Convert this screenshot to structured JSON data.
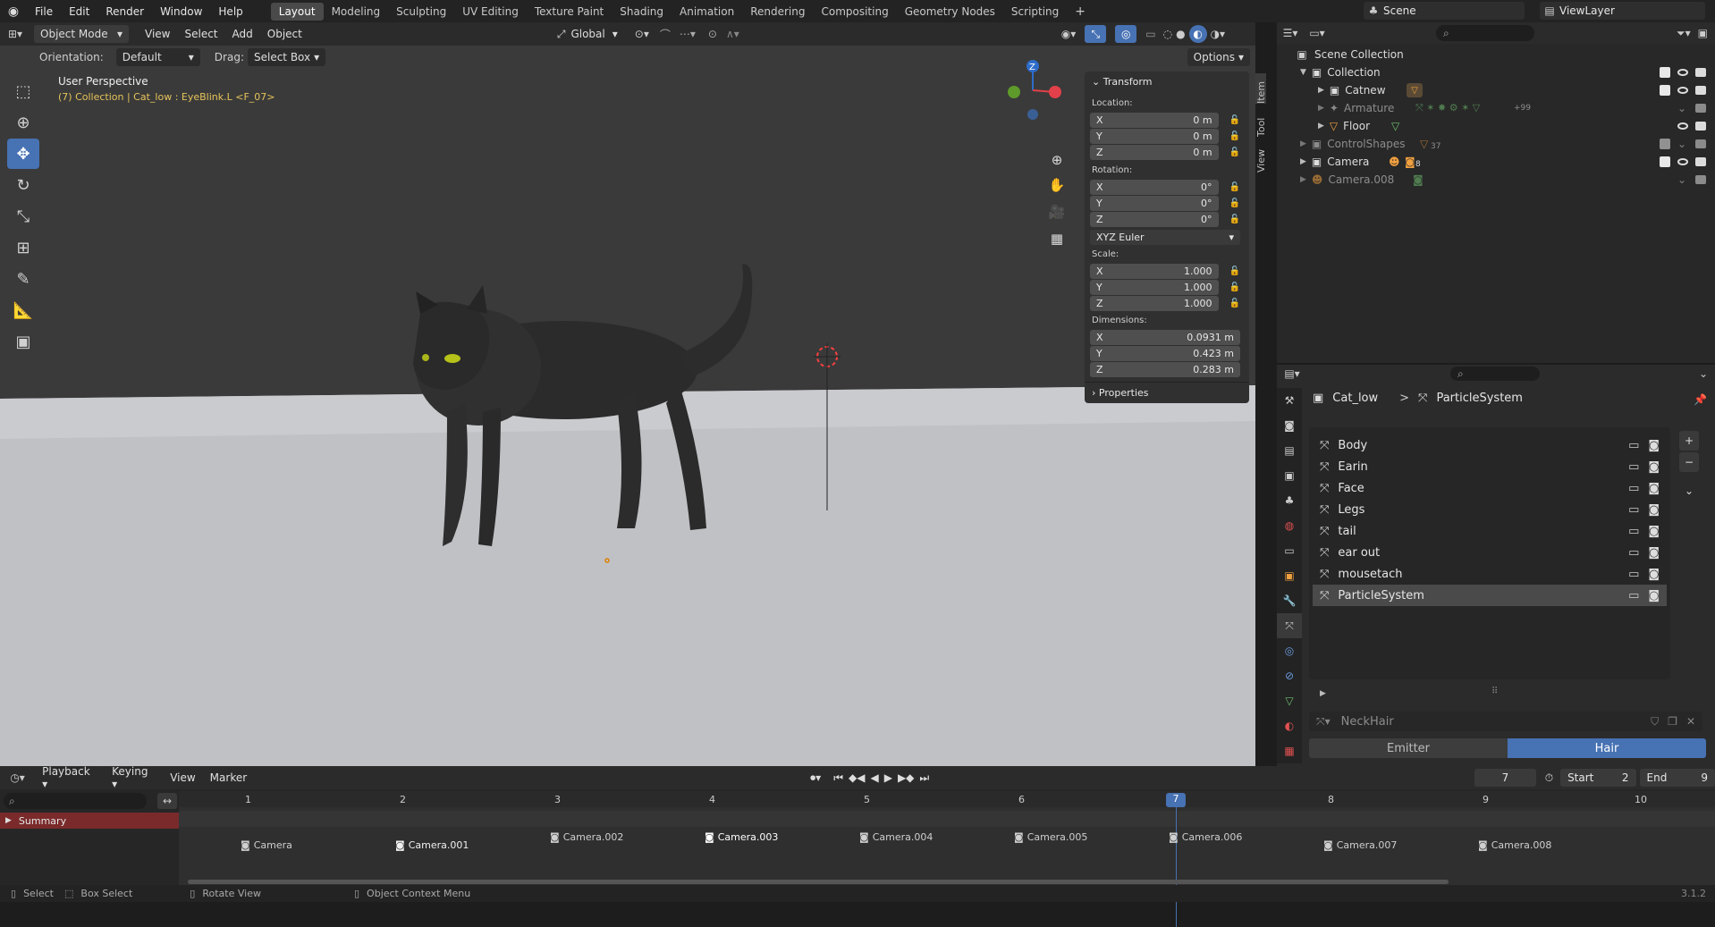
{
  "topbar": {
    "menus": [
      "File",
      "Edit",
      "Render",
      "Window",
      "Help"
    ],
    "workspaces": [
      "Layout",
      "Modeling",
      "Sculpting",
      "UV Editing",
      "Texture Paint",
      "Shading",
      "Animation",
      "Rendering",
      "Compositing",
      "Geometry Nodes",
      "Scripting"
    ],
    "active_workspace": "Layout",
    "scene": "Scene",
    "viewlayer": "ViewLayer"
  },
  "viewport_header": {
    "mode": "Object Mode",
    "menus": [
      "View",
      "Select",
      "Add",
      "Object"
    ],
    "transform_orientation": "Global",
    "options": "Options"
  },
  "tool_settings": {
    "orientation_label": "Orientation:",
    "orientation_value": "Default",
    "drag_label": "Drag:",
    "drag_value": "Select Box"
  },
  "viewport": {
    "view_name": "User Perspective",
    "info_line": "(7) Collection | Cat_low : EyeBlink.L <F_07>",
    "colors": {
      "floor": "#c0c1c5",
      "background": "#393939",
      "accent": "#4772b3",
      "info": "#e6c35a"
    }
  },
  "side_tabs": [
    "Item",
    "Tool",
    "View"
  ],
  "transform": {
    "title": "Transform",
    "location_label": "Location:",
    "location": [
      {
        "axis": "X",
        "value": "0 m"
      },
      {
        "axis": "Y",
        "value": "0 m"
      },
      {
        "axis": "Z",
        "value": "0 m"
      }
    ],
    "rotation_label": "Rotation:",
    "rotation": [
      {
        "axis": "X",
        "value": "0°"
      },
      {
        "axis": "Y",
        "value": "0°"
      },
      {
        "axis": "Z",
        "value": "0°"
      }
    ],
    "rotation_mode": "XYZ Euler",
    "scale_label": "Scale:",
    "scale": [
      {
        "axis": "X",
        "value": "1.000"
      },
      {
        "axis": "Y",
        "value": "1.000"
      },
      {
        "axis": "Z",
        "value": "1.000"
      }
    ],
    "dimensions_label": "Dimensions:",
    "dimensions": [
      {
        "axis": "X",
        "value": "0.0931 m"
      },
      {
        "axis": "Y",
        "value": "0.423 m"
      },
      {
        "axis": "Z",
        "value": "0.283 m"
      }
    ],
    "properties_label": "Properties"
  },
  "outliner": {
    "items": [
      {
        "label": "Scene Collection",
        "badge": ""
      },
      {
        "label": "Collection",
        "badge": ""
      },
      {
        "label": "Catnew",
        "badge": ""
      },
      {
        "label": "Armature",
        "badge": "+99"
      },
      {
        "label": "Floor",
        "badge": ""
      },
      {
        "label": "ControlShapes",
        "badge": "37"
      },
      {
        "label": "Camera",
        "badge": "8"
      },
      {
        "label": "Camera.008",
        "badge": ""
      }
    ]
  },
  "properties": {
    "breadcrumb_object": "Cat_low",
    "breadcrumb_sep": ">",
    "breadcrumb_system": "ParticleSystem",
    "particle_systems": [
      "Body",
      "Earin",
      "Face",
      "Legs",
      "tail",
      "ear out",
      "mousetach",
      "ParticleSystem"
    ],
    "selected": "ParticleSystem",
    "settings_name": "NeckHair",
    "type_buttons": [
      "Emitter",
      "Hair"
    ],
    "active_type": "Hair"
  },
  "timeline": {
    "menus": [
      "Playback",
      "Keying",
      "View",
      "Marker"
    ],
    "current_frame": "7",
    "start_label": "Start",
    "start": "2",
    "end_label": "End",
    "end": "9",
    "ruler": [
      "1",
      "2",
      "3",
      "4",
      "5",
      "6",
      "7",
      "8",
      "9",
      "10"
    ],
    "summary": "Summary",
    "markers": [
      "Camera",
      "Camera.001",
      "Camera.002",
      "Camera.003",
      "Camera.004",
      "Camera.005",
      "Camera.006",
      "Camera.007",
      "Camera.008"
    ]
  },
  "status": {
    "items": [
      "Select",
      "Box Select",
      "Rotate View",
      "Object Context Menu"
    ],
    "version": "3.1.2"
  }
}
